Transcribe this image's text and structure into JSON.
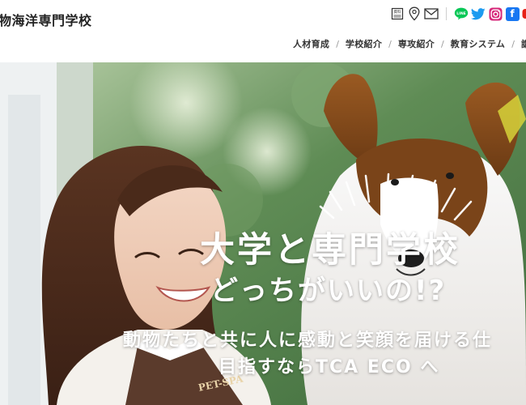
{
  "site": {
    "title": "物海洋専門学校"
  },
  "header_icons": {
    "items": [
      "brochure-icon",
      "map-pin-icon",
      "mail-icon",
      "line-icon",
      "twitter-icon",
      "instagram-icon",
      "facebook-icon",
      "youtube-icon"
    ],
    "line_label": "LINE",
    "facebook_label": "f",
    "brochure_label": "資料"
  },
  "nav": {
    "items": [
      "人材育成",
      "学校紹介",
      "専攻紹介",
      "教育システム",
      "講師"
    ]
  },
  "hero": {
    "headline_1": "大学と専門学校",
    "headline_2": "どっちがいいの!?",
    "sub_1": "動物たちと共に人に感動と笑顔を届ける仕",
    "sub_2": "目指すならTCA ECO へ",
    "apron_text": "PET-SPA"
  },
  "colors": {
    "line": "#06c755",
    "twitter": "#1d9bf0",
    "instagram": "#d6287a",
    "facebook": "#1877f2",
    "youtube": "#e62117"
  }
}
